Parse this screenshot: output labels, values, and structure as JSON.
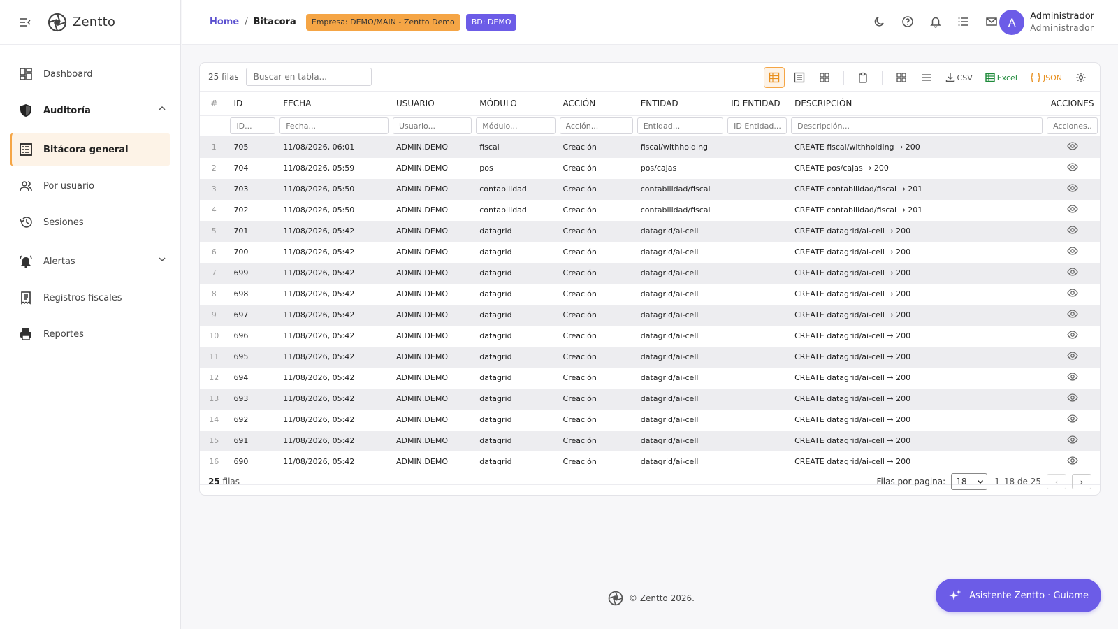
{
  "app": {
    "name": "Zentto"
  },
  "sidebar": {
    "items": [
      {
        "label": "Dashboard",
        "icon": "dashboard-icon"
      },
      {
        "label": "Auditoría",
        "icon": "shield-icon"
      },
      {
        "label": "Bitácora general",
        "icon": "list-icon"
      },
      {
        "label": "Por usuario",
        "icon": "users-icon"
      },
      {
        "label": "Sesiones",
        "icon": "history-icon"
      },
      {
        "label": "Alertas",
        "icon": "bell-alert-icon"
      },
      {
        "label": "Registros fiscales",
        "icon": "receipt-icon"
      },
      {
        "label": "Reportes",
        "icon": "printer-icon"
      }
    ]
  },
  "header": {
    "breadcrumb_home": "Home",
    "breadcrumb_sep": "/",
    "breadcrumb_current": "Bitacora",
    "company_chip": "Empresa: DEMO/MAIN - Zentto Demo",
    "db_chip": "BD: DEMO",
    "user_initial": "A",
    "user_name": "Administrador",
    "user_role": "Administrador"
  },
  "table": {
    "row_count_label": "25 filas",
    "search_placeholder": "Buscar en tabla...",
    "export": {
      "csv": "CSV",
      "excel": "Excel",
      "json": "JSON"
    },
    "columns": [
      "#",
      "ID",
      "FECHA",
      "USUARIO",
      "MÓDULO",
      "ACCIÓN",
      "ENTIDAD",
      "ID ENTIDAD",
      "DESCRIPCIÓN",
      "ACCIONES"
    ],
    "filters": [
      "ID...",
      "Fecha...",
      "Usuario...",
      "Módulo...",
      "Acción...",
      "Entidad...",
      "ID Entidad...",
      "Descripción...",
      "Acciones..."
    ],
    "rows": [
      [
        "1",
        "705",
        "11/08/2026, 06:01",
        "ADMIN.DEMO",
        "fiscal",
        "Creación",
        "fiscal/withholding",
        "",
        "CREATE fiscal/withholding → 200"
      ],
      [
        "2",
        "704",
        "11/08/2026, 05:59",
        "ADMIN.DEMO",
        "pos",
        "Creación",
        "pos/cajas",
        "",
        "CREATE pos/cajas → 200"
      ],
      [
        "3",
        "703",
        "11/08/2026, 05:50",
        "ADMIN.DEMO",
        "contabilidad",
        "Creación",
        "contabilidad/fiscal",
        "",
        "CREATE contabilidad/fiscal → 201"
      ],
      [
        "4",
        "702",
        "11/08/2026, 05:50",
        "ADMIN.DEMO",
        "contabilidad",
        "Creación",
        "contabilidad/fiscal",
        "",
        "CREATE contabilidad/fiscal → 201"
      ],
      [
        "5",
        "701",
        "11/08/2026, 05:42",
        "ADMIN.DEMO",
        "datagrid",
        "Creación",
        "datagrid/ai-cell",
        "",
        "CREATE datagrid/ai-cell → 200"
      ],
      [
        "6",
        "700",
        "11/08/2026, 05:42",
        "ADMIN.DEMO",
        "datagrid",
        "Creación",
        "datagrid/ai-cell",
        "",
        "CREATE datagrid/ai-cell → 200"
      ],
      [
        "7",
        "699",
        "11/08/2026, 05:42",
        "ADMIN.DEMO",
        "datagrid",
        "Creación",
        "datagrid/ai-cell",
        "",
        "CREATE datagrid/ai-cell → 200"
      ],
      [
        "8",
        "698",
        "11/08/2026, 05:42",
        "ADMIN.DEMO",
        "datagrid",
        "Creación",
        "datagrid/ai-cell",
        "",
        "CREATE datagrid/ai-cell → 200"
      ],
      [
        "9",
        "697",
        "11/08/2026, 05:42",
        "ADMIN.DEMO",
        "datagrid",
        "Creación",
        "datagrid/ai-cell",
        "",
        "CREATE datagrid/ai-cell → 200"
      ],
      [
        "10",
        "696",
        "11/08/2026, 05:42",
        "ADMIN.DEMO",
        "datagrid",
        "Creación",
        "datagrid/ai-cell",
        "",
        "CREATE datagrid/ai-cell → 200"
      ],
      [
        "11",
        "695",
        "11/08/2026, 05:42",
        "ADMIN.DEMO",
        "datagrid",
        "Creación",
        "datagrid/ai-cell",
        "",
        "CREATE datagrid/ai-cell → 200"
      ],
      [
        "12",
        "694",
        "11/08/2026, 05:42",
        "ADMIN.DEMO",
        "datagrid",
        "Creación",
        "datagrid/ai-cell",
        "",
        "CREATE datagrid/ai-cell → 200"
      ],
      [
        "13",
        "693",
        "11/08/2026, 05:42",
        "ADMIN.DEMO",
        "datagrid",
        "Creación",
        "datagrid/ai-cell",
        "",
        "CREATE datagrid/ai-cell → 200"
      ],
      [
        "14",
        "692",
        "11/08/2026, 05:42",
        "ADMIN.DEMO",
        "datagrid",
        "Creación",
        "datagrid/ai-cell",
        "",
        "CREATE datagrid/ai-cell → 200"
      ],
      [
        "15",
        "691",
        "11/08/2026, 05:42",
        "ADMIN.DEMO",
        "datagrid",
        "Creación",
        "datagrid/ai-cell",
        "",
        "CREATE datagrid/ai-cell → 200"
      ],
      [
        "16",
        "690",
        "11/08/2026, 05:42",
        "ADMIN.DEMO",
        "datagrid",
        "Creación",
        "datagrid/ai-cell",
        "",
        "CREATE datagrid/ai-cell → 200"
      ]
    ]
  },
  "footer": {
    "count_number": "25",
    "count_suffix": "filas",
    "rows_per_page_label": "Filas por pagina:",
    "rows_per_page_value": "18",
    "range": "1–18 de 25",
    "prev": "‹",
    "next": "›"
  },
  "copyright": "© Zentto 2026.",
  "assistant_button": "Asistente Zentto · Guíame",
  "colors": {
    "accent": "#6c5ce7",
    "highlight": "#f5a545",
    "excel": "#1e8a3a",
    "json": "#e8901f"
  }
}
